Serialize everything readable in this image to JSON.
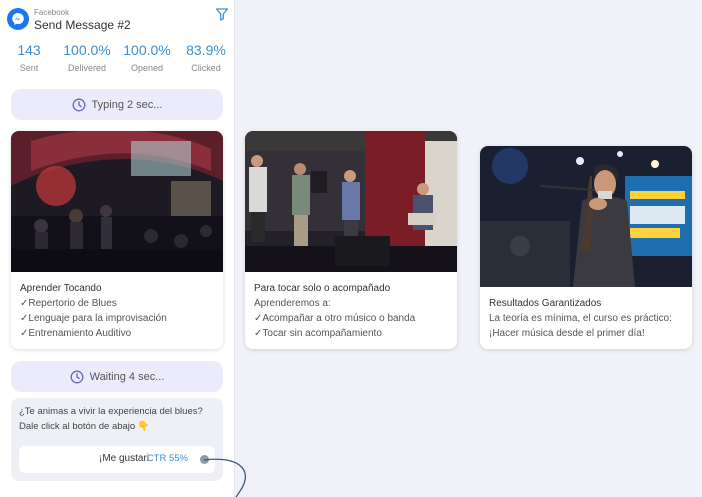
{
  "node": {
    "source": "Facebook",
    "title": "Send Message #2",
    "icons": {
      "logo": "messenger-icon",
      "filter": "filter-icon"
    }
  },
  "stats": [
    {
      "value": "143",
      "label": "Sent"
    },
    {
      "value": "100.0%",
      "label": "Delivered"
    },
    {
      "value": "100.0%",
      "label": "Opened"
    },
    {
      "value": "83.9%",
      "label": "Clicked"
    }
  ],
  "typing": {
    "label": "Typing 2 sec...",
    "icon": "clock-icon"
  },
  "waiting": {
    "label": "Waiting 4 sec...",
    "icon": "clock-icon"
  },
  "cards": [
    {
      "title": "Aprender Tocando",
      "lines": [
        "✓Repertorio de Blues",
        "✓Lenguaje para la improvisación",
        "✓Entrenamiento Auditivo"
      ]
    },
    {
      "title": "Para tocar solo o acompañado",
      "lines": [
        "Aprenderemos a:",
        "✓Acompañar a otro músico o banda",
        "✓Tocar sin acompañamiento"
      ]
    },
    {
      "title": "Resultados Garantizados",
      "lines": [
        "La teoría es mínima, el curso es práctico:",
        "¡Hacer música desde el primer día!"
      ]
    }
  ],
  "message": {
    "line1": "¿Te animas a vivir la experiencia del blues?",
    "line2": "Dale click al botón de abajo 👇",
    "button_label": "¡Me gustari",
    "button_ctr": "CTR 55%"
  },
  "colors": {
    "accent": "#3e8ed0",
    "pill_bg": "#ecebfb",
    "brand": "#1877f2"
  }
}
